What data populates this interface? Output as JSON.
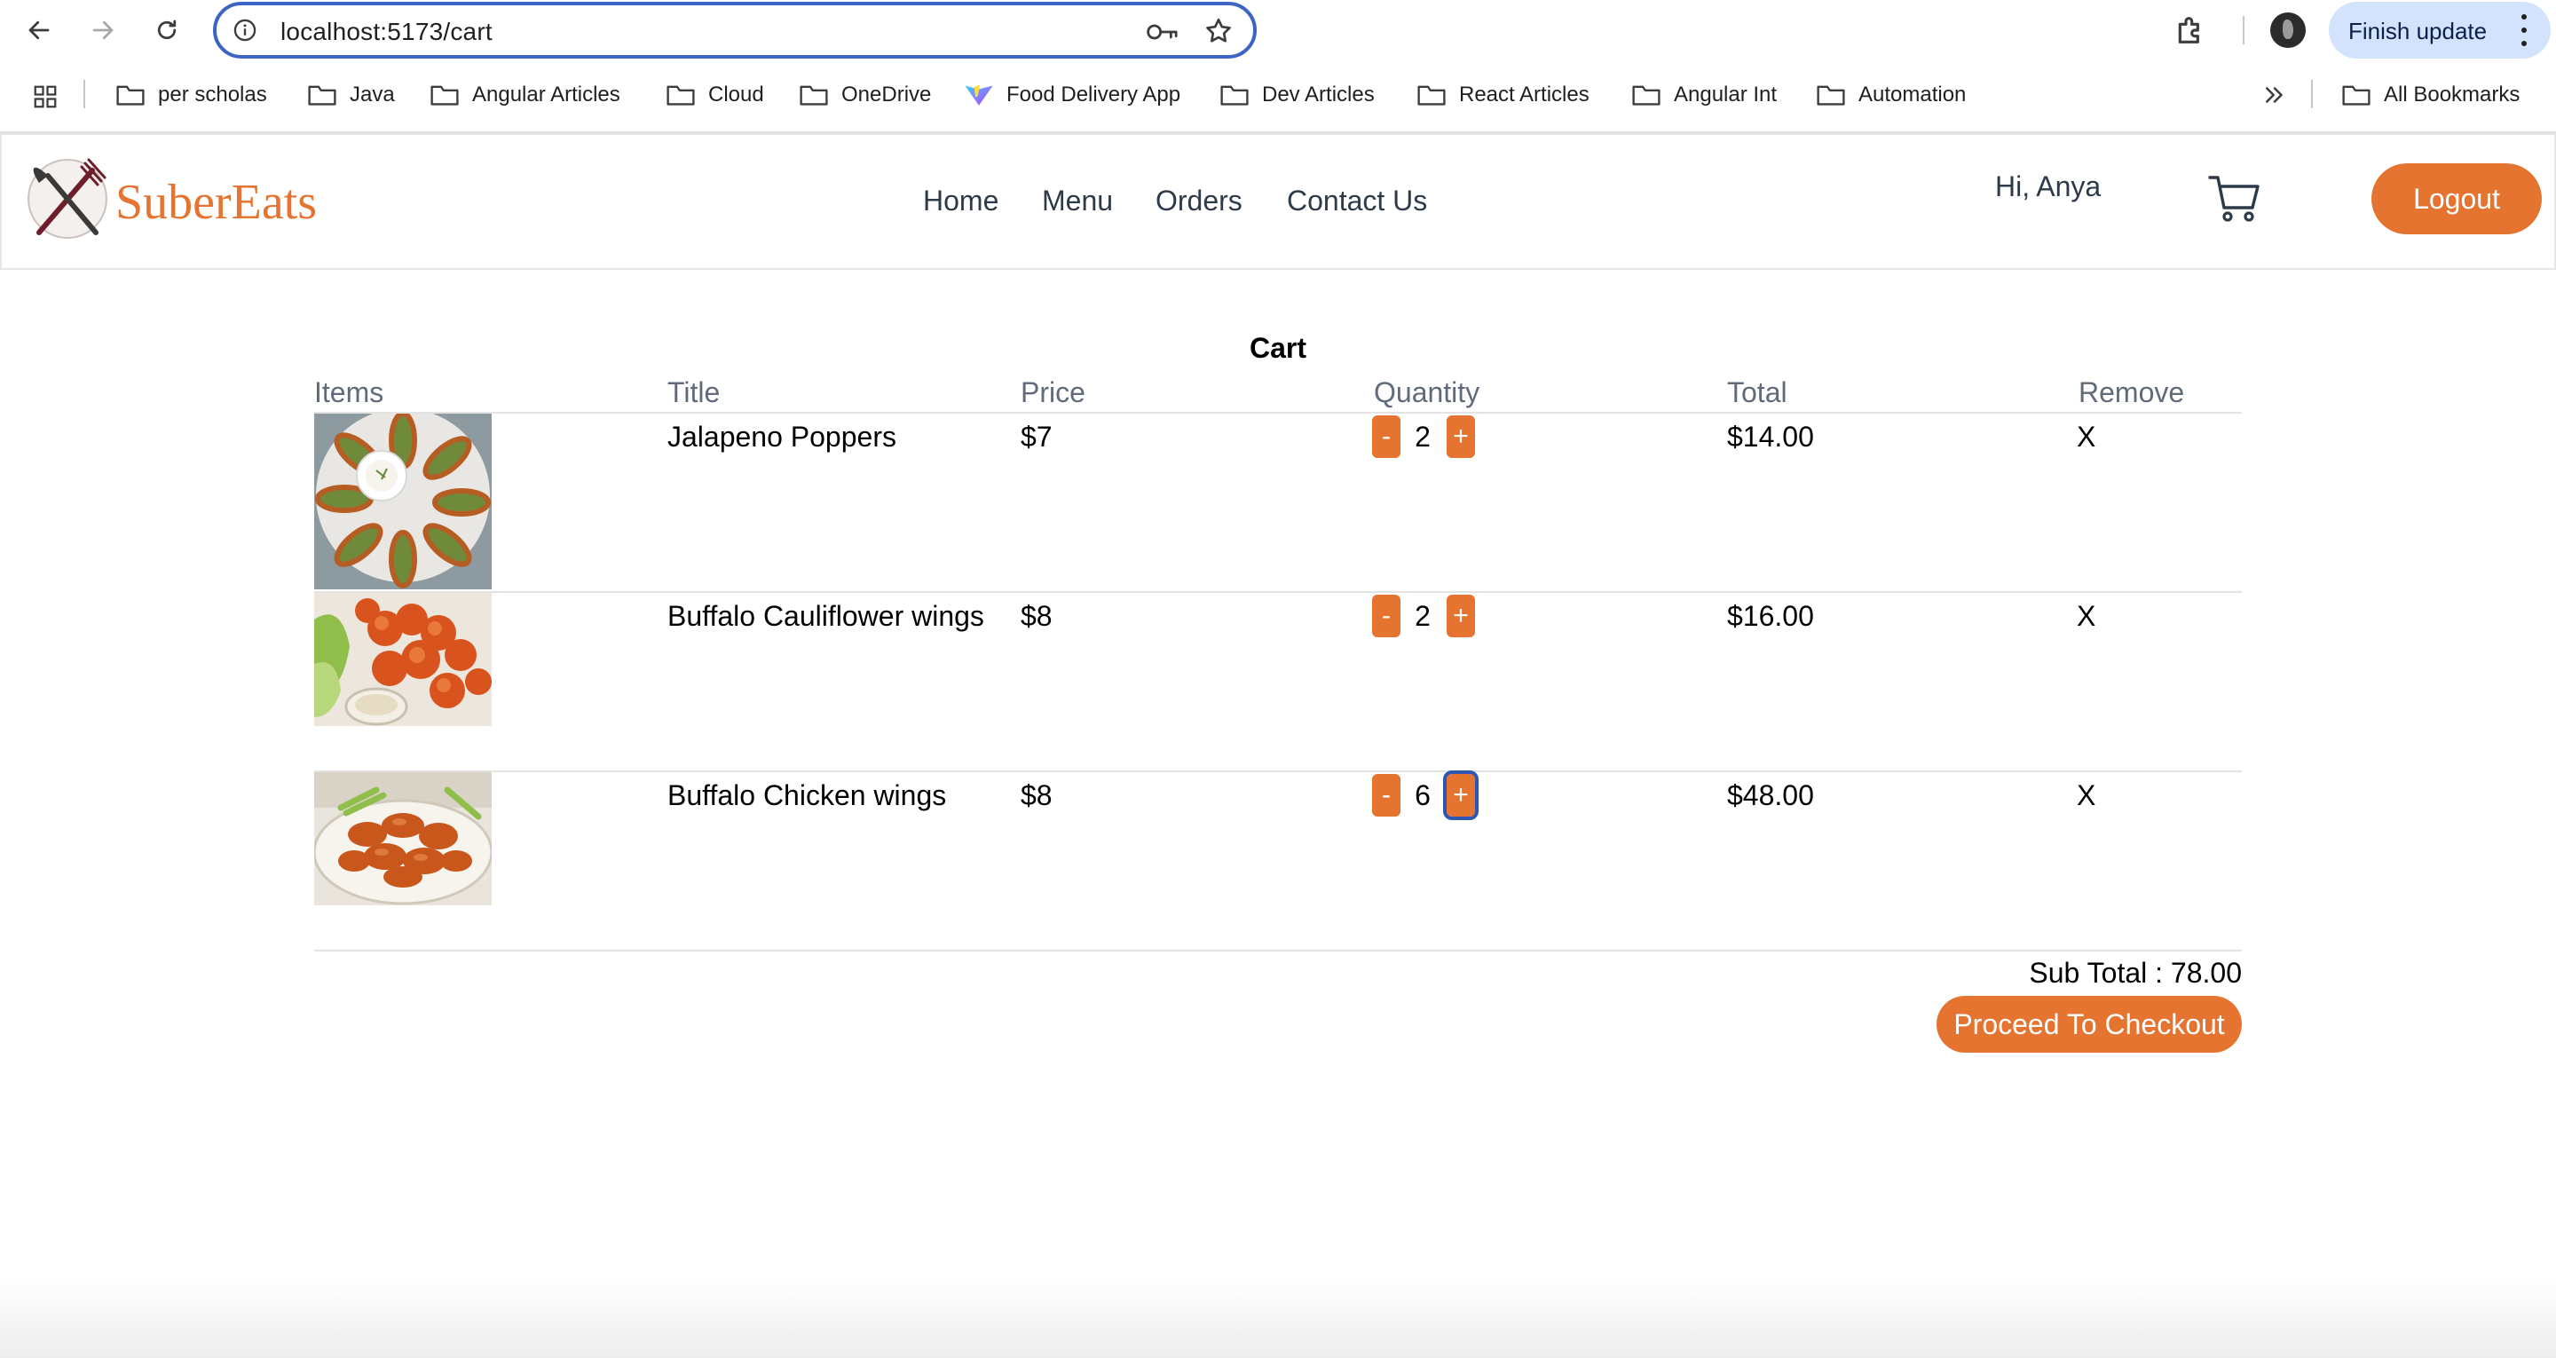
{
  "browser": {
    "url": "localhost:5173/cart",
    "update_label": "Finish update",
    "bookmarks": [
      "per scholas",
      "Java",
      "Angular Articles",
      "Cloud",
      "OneDrive",
      "Food Delivery App",
      "Dev Articles",
      "React Articles",
      "Angular Int",
      "Automation"
    ],
    "all_bookmarks_label": "All Bookmarks"
  },
  "header": {
    "brand": "SuberEats",
    "nav": [
      "Home",
      "Menu",
      "Orders",
      "Contact Us"
    ],
    "greeting": "Hi, Anya",
    "logout_label": "Logout"
  },
  "cart": {
    "title": "Cart",
    "columns": [
      "Items",
      "Title",
      "Price",
      "Quantity",
      "Total",
      "Remove"
    ],
    "rows": [
      {
        "title": "Jalapeno Poppers",
        "price": "$7",
        "quantity": "2",
        "total": "$14.00",
        "remove": "X",
        "image": "jalapeno-poppers-photo"
      },
      {
        "title": "Buffalo Cauliflower wings",
        "price": "$8",
        "quantity": "2",
        "total": "$16.00",
        "remove": "X",
        "image": "buffalo-cauliflower-wings-photo"
      },
      {
        "title": "Buffalo Chicken wings",
        "price": "$8",
        "quantity": "6",
        "total": "$48.00",
        "remove": "X",
        "image": "buffalo-chicken-wings-photo"
      }
    ],
    "minus_label": "-",
    "plus_label": "+",
    "subtotal": "Sub Total : 78.00",
    "checkout_label": "Proceed To Checkout"
  },
  "colors": {
    "accent": "#e57431",
    "focus_ring": "#2f56b3",
    "omnibox_border": "#3b64c4",
    "update_button_bg": "#d3e3fd"
  }
}
